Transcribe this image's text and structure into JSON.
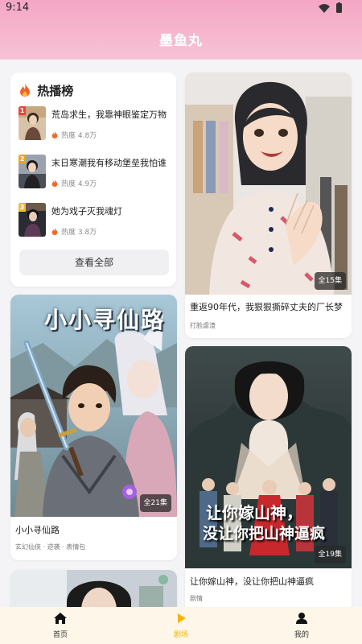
{
  "status_bar": {
    "time": "9:14",
    "wifi_icon": "wifi-icon",
    "battery_icon": "battery-icon"
  },
  "header": {
    "title": "墨鱼丸"
  },
  "hot_list": {
    "title": "热播榜",
    "icon": "fire-icon",
    "items": [
      {
        "rank": "1",
        "title": "荒岛求生，我靠神眼鉴定万物",
        "heat": "热度 4.8万"
      },
      {
        "rank": "2",
        "title": "末日寒潮我有移动堡垒我怕谁",
        "heat": "热度 4.9万"
      },
      {
        "rank": "3",
        "title": "她为戏子灭我魂灯",
        "heat": "热度 3.8万"
      }
    ],
    "view_all": "查看全部"
  },
  "dramas": [
    {
      "title": "重返90年代，我狠狠撕碎丈夫的厂长梦",
      "tag": "打脸虐渣",
      "episodes": "全15集"
    },
    {
      "title": "小小寻仙路",
      "tag": "玄幻仙侠 · 逆袭 · 表情包",
      "episodes": "全21集",
      "poster_text": "小小寻仙路"
    },
    {
      "title": "让你嫁山神，没让你把山神逼疯",
      "tag": "剧情",
      "episodes": "全19集",
      "poster_text": [
        "让你嫁山神，",
        "没让你把山神逼疯"
      ]
    }
  ],
  "bottom_nav": [
    {
      "label": "首页",
      "icon": "home-icon",
      "active": false
    },
    {
      "label": "剧场",
      "icon": "play-icon",
      "active": true
    },
    {
      "label": "我的",
      "icon": "user-icon",
      "active": false
    }
  ],
  "colors": {
    "header_top": "#f4a6c4",
    "active_tab": "#f5b400",
    "nav_bg": "#fef6e8"
  }
}
